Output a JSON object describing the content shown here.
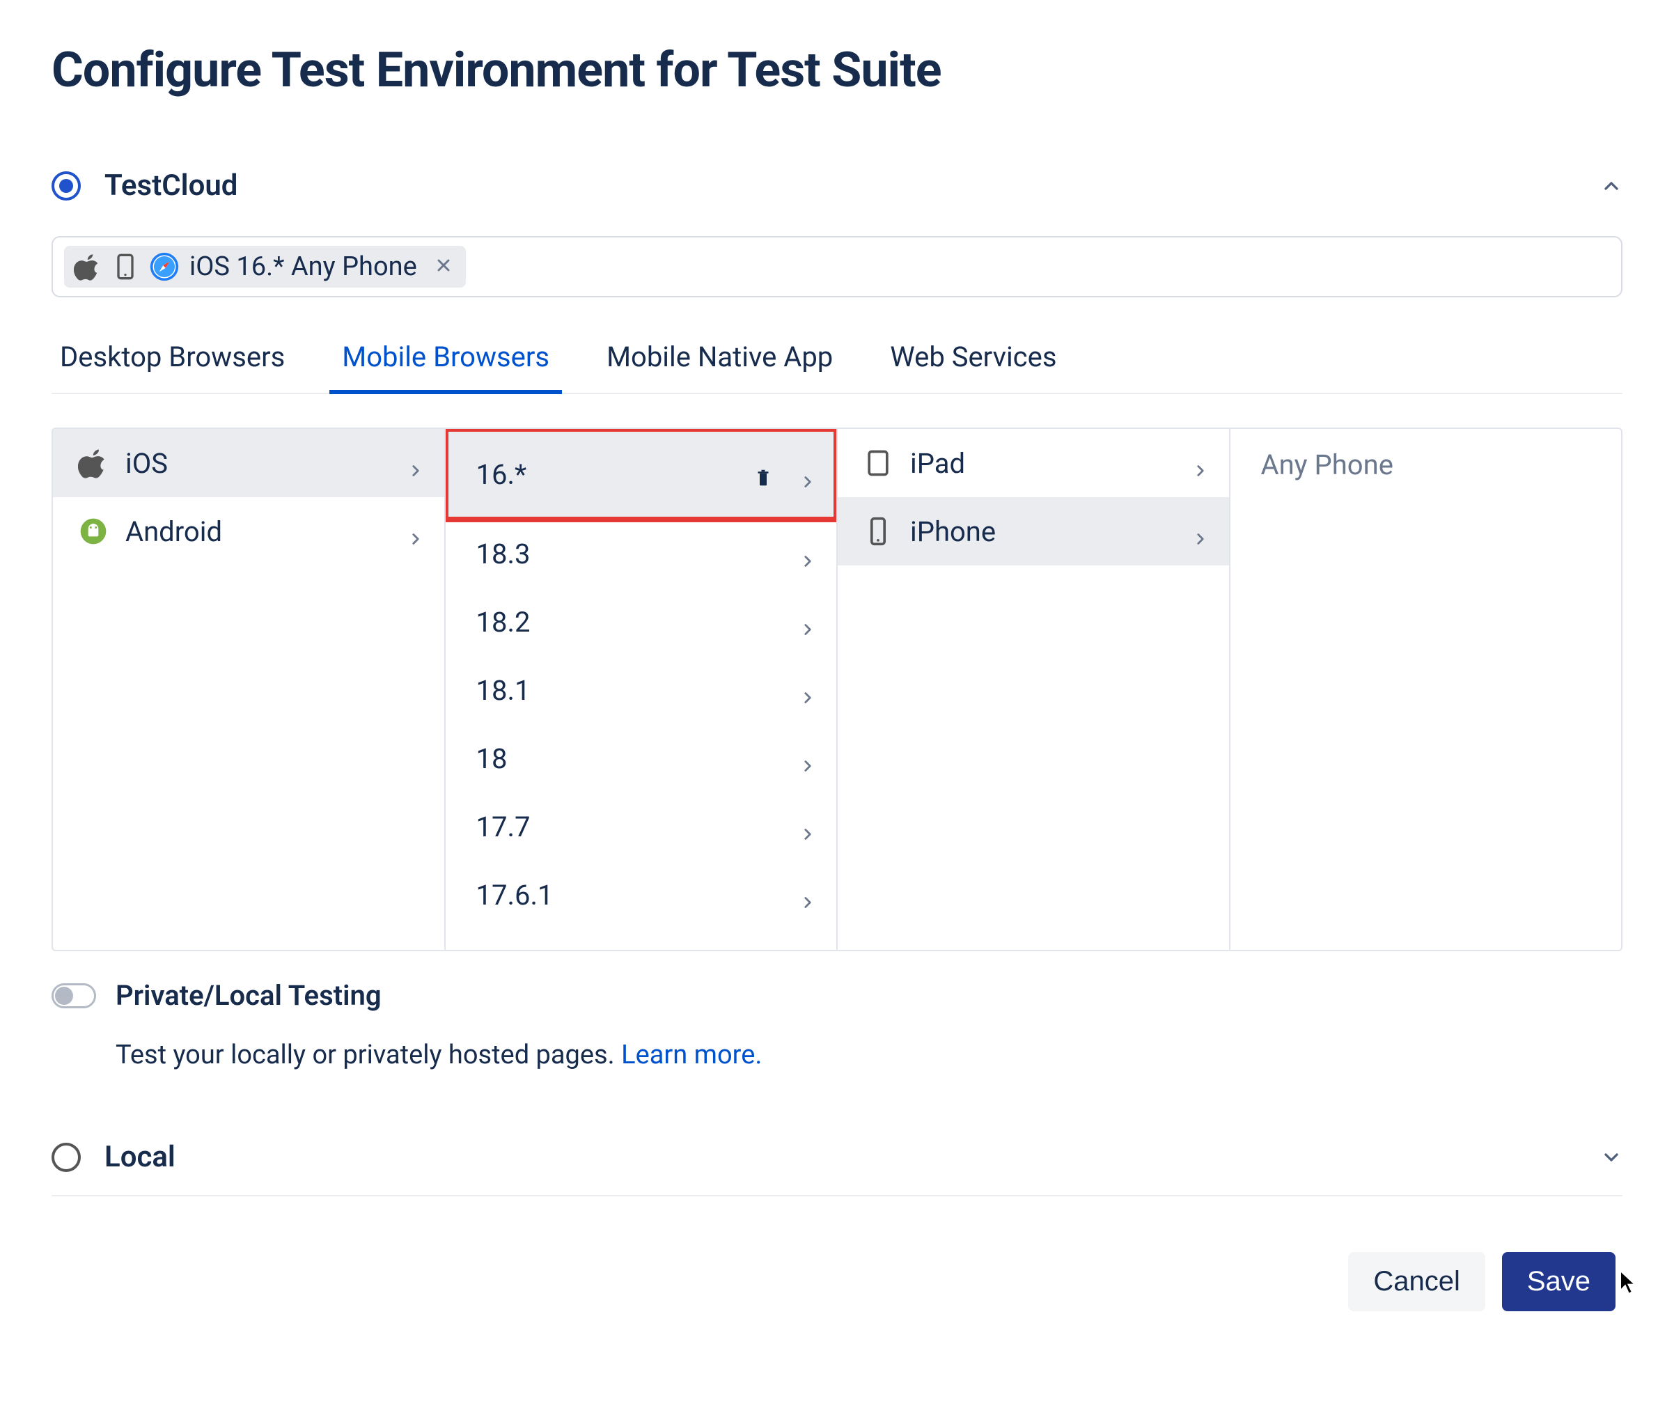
{
  "title": "Configure Test Environment for Test Suite",
  "sections": {
    "testcloud": {
      "label": "TestCloud",
      "selected": true,
      "expanded": true
    },
    "local": {
      "label": "Local",
      "selected": false,
      "expanded": false
    }
  },
  "chip": {
    "text": "iOS 16.* Any Phone"
  },
  "tabs": [
    {
      "label": "Desktop Browsers",
      "active": false
    },
    {
      "label": "Mobile Browsers",
      "active": true
    },
    {
      "label": "Mobile Native App",
      "active": false
    },
    {
      "label": "Web Services",
      "active": false
    }
  ],
  "platforms": [
    {
      "label": "iOS",
      "selected": true
    },
    {
      "label": "Android",
      "selected": false
    }
  ],
  "versions": [
    {
      "label": "16.*",
      "selected": true,
      "highlighted": true,
      "deletable": true
    },
    {
      "label": "18.3",
      "selected": false
    },
    {
      "label": "18.2",
      "selected": false
    },
    {
      "label": "18.1",
      "selected": false
    },
    {
      "label": "18",
      "selected": false
    },
    {
      "label": "17.7",
      "selected": false
    },
    {
      "label": "17.6.1",
      "selected": false
    }
  ],
  "deviceTypes": [
    {
      "label": "iPad",
      "selected": false
    },
    {
      "label": "iPhone",
      "selected": true
    }
  ],
  "finalColumn": {
    "label": "Any Phone"
  },
  "privateLocal": {
    "label": "Private/Local Testing",
    "desc": "Test your locally or privately hosted pages. ",
    "learnMore": "Learn more."
  },
  "buttons": {
    "cancel": "Cancel",
    "save": "Save"
  }
}
